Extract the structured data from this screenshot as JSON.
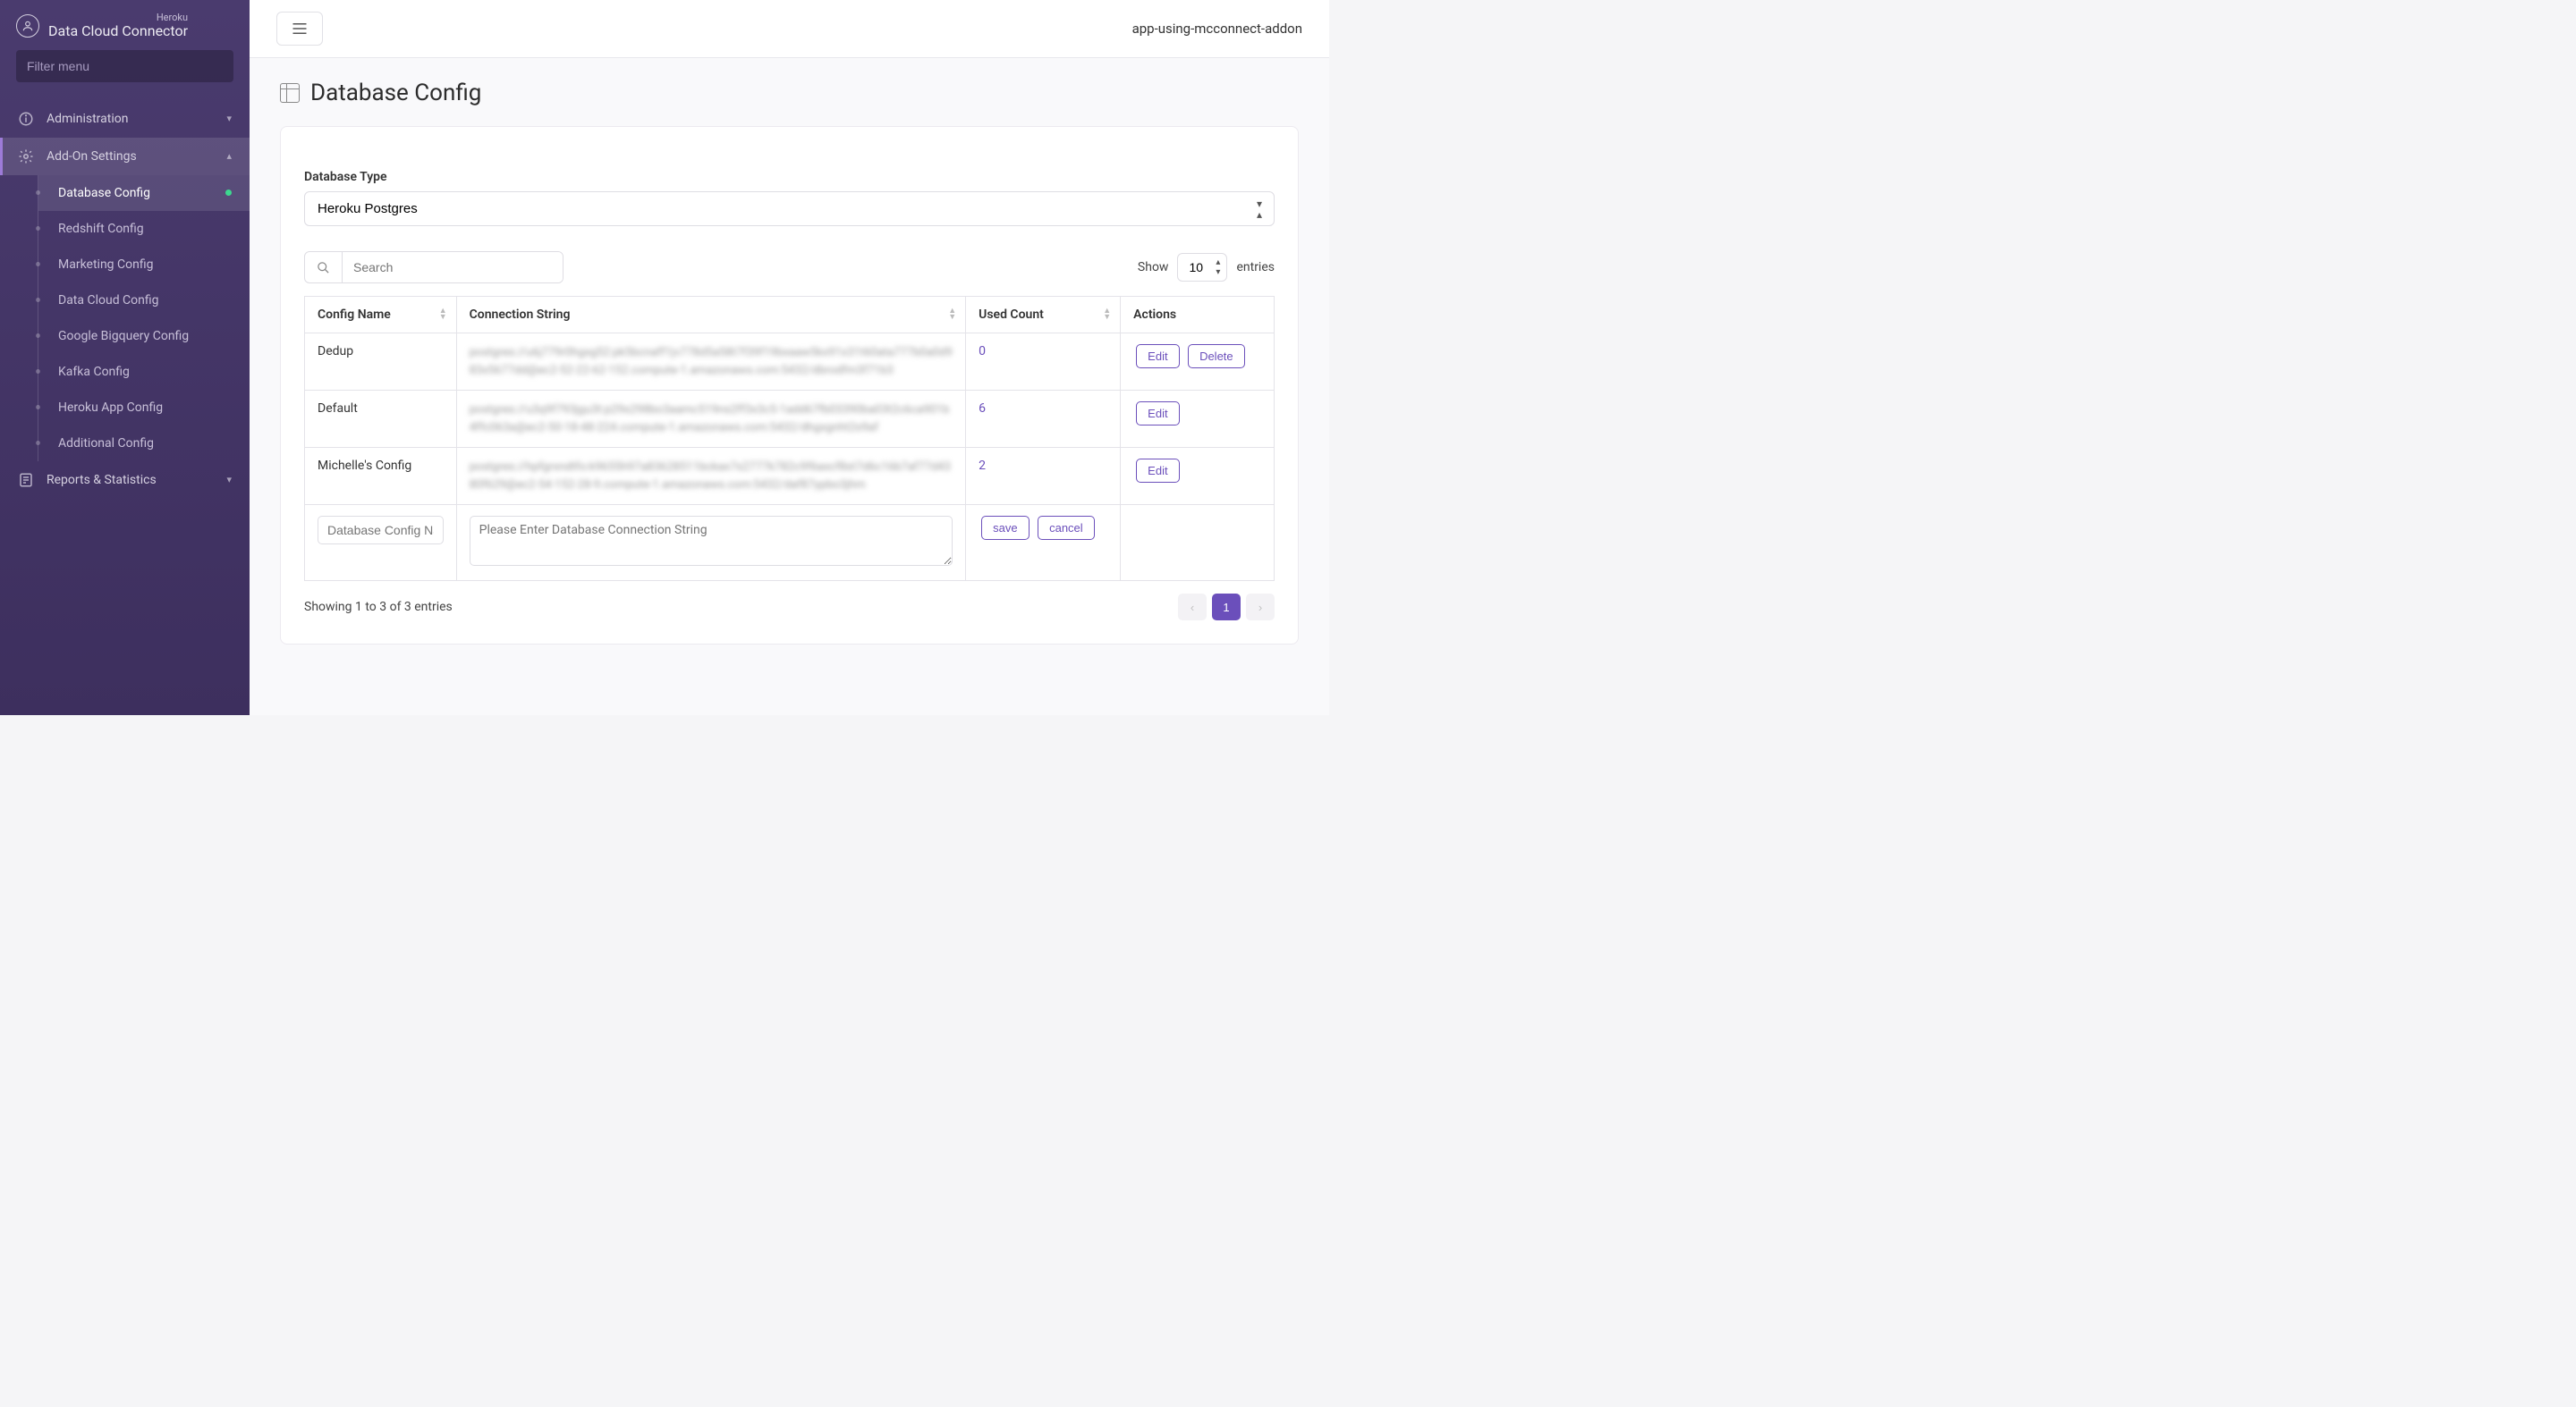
{
  "brand": {
    "small": "Heroku",
    "large": "Data Cloud Connector"
  },
  "sidebar": {
    "filter_placeholder": "Filter menu",
    "groups": [
      {
        "label": "Administration",
        "expanded": false
      },
      {
        "label": "Add-On Settings",
        "expanded": true,
        "items": [
          {
            "label": "Database Config",
            "active": true,
            "indicator": true
          },
          {
            "label": "Redshift Config"
          },
          {
            "label": "Marketing Config"
          },
          {
            "label": "Data Cloud Config"
          },
          {
            "label": "Google Bigquery Config"
          },
          {
            "label": "Kafka Config"
          },
          {
            "label": "Heroku App Config"
          },
          {
            "label": "Additional Config"
          }
        ]
      },
      {
        "label": "Reports & Statistics",
        "expanded": false
      }
    ]
  },
  "topbar": {
    "app_name": "app-using-mcconnect-addon"
  },
  "page": {
    "title": "Database Config"
  },
  "db_type": {
    "label": "Database Type",
    "selected": "Heroku Postgres"
  },
  "search": {
    "placeholder": "Search"
  },
  "entries": {
    "show_label": "Show",
    "value": "10",
    "suffix": "entries"
  },
  "table": {
    "columns": {
      "name": "Config Name",
      "conn": "Connection String",
      "used": "Used Count",
      "actions": "Actions"
    },
    "rows": [
      {
        "name": "Dedup",
        "conn": "postgres://u6j779r0hgxg52:pk5bcnaff1jv778d5a58t7f39f19bxaaw5kx91x31t60ata777b0a0d983x5677dd@ec2-52-22-62-152.compute-1.amazonaws.com:5432/dbrodfm3f71b3",
        "used": "0",
        "actions": [
          "Edit",
          "Delete"
        ]
      },
      {
        "name": "Default",
        "conn": "postgres://u3q9f793jgu3t:p29s298bo3aamc519ns2ff3x3c5-1add67fb03390ba03t2c6ca901b4ffc063a@ec2-50-18-48-224.compute-1.amazonaws.com:5432/dhgxgnht2s9af",
        "used": "6",
        "actions": [
          "Edit"
        ]
      },
      {
        "name": "Michelle's Config",
        "conn": "postgres://hpfgrxndtfo:k9655h97a83628511bckax7s2777k782c9f6axcf8st7d6c16b7af77d4380f629@ec2-54-152-28-9.compute-1.amazonaws.com:5432/daf87ypbo3jhm",
        "used": "2",
        "actions": [
          "Edit"
        ]
      }
    ],
    "new_row": {
      "name_placeholder": "Database Config Name",
      "conn_placeholder": "Please Enter Database Connection String",
      "save": "save",
      "cancel": "cancel"
    },
    "footer_info": "Showing 1 to 3 of 3 entries",
    "page_current": "1"
  }
}
